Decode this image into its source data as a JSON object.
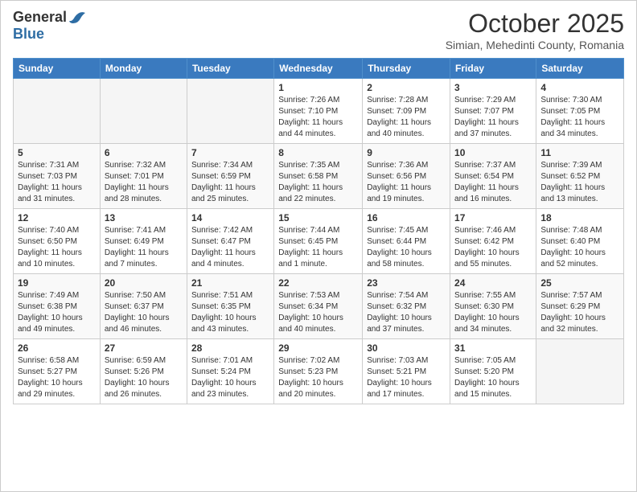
{
  "header": {
    "logo_line1": "General",
    "logo_line2": "Blue",
    "month": "October 2025",
    "location": "Simian, Mehedinti County, Romania"
  },
  "weekdays": [
    "Sunday",
    "Monday",
    "Tuesday",
    "Wednesday",
    "Thursday",
    "Friday",
    "Saturday"
  ],
  "weeks": [
    [
      {
        "day": "",
        "info": ""
      },
      {
        "day": "",
        "info": ""
      },
      {
        "day": "",
        "info": ""
      },
      {
        "day": "1",
        "info": "Sunrise: 7:26 AM\nSunset: 7:10 PM\nDaylight: 11 hours\nand 44 minutes."
      },
      {
        "day": "2",
        "info": "Sunrise: 7:28 AM\nSunset: 7:09 PM\nDaylight: 11 hours\nand 40 minutes."
      },
      {
        "day": "3",
        "info": "Sunrise: 7:29 AM\nSunset: 7:07 PM\nDaylight: 11 hours\nand 37 minutes."
      },
      {
        "day": "4",
        "info": "Sunrise: 7:30 AM\nSunset: 7:05 PM\nDaylight: 11 hours\nand 34 minutes."
      }
    ],
    [
      {
        "day": "5",
        "info": "Sunrise: 7:31 AM\nSunset: 7:03 PM\nDaylight: 11 hours\nand 31 minutes."
      },
      {
        "day": "6",
        "info": "Sunrise: 7:32 AM\nSunset: 7:01 PM\nDaylight: 11 hours\nand 28 minutes."
      },
      {
        "day": "7",
        "info": "Sunrise: 7:34 AM\nSunset: 6:59 PM\nDaylight: 11 hours\nand 25 minutes."
      },
      {
        "day": "8",
        "info": "Sunrise: 7:35 AM\nSunset: 6:58 PM\nDaylight: 11 hours\nand 22 minutes."
      },
      {
        "day": "9",
        "info": "Sunrise: 7:36 AM\nSunset: 6:56 PM\nDaylight: 11 hours\nand 19 minutes."
      },
      {
        "day": "10",
        "info": "Sunrise: 7:37 AM\nSunset: 6:54 PM\nDaylight: 11 hours\nand 16 minutes."
      },
      {
        "day": "11",
        "info": "Sunrise: 7:39 AM\nSunset: 6:52 PM\nDaylight: 11 hours\nand 13 minutes."
      }
    ],
    [
      {
        "day": "12",
        "info": "Sunrise: 7:40 AM\nSunset: 6:50 PM\nDaylight: 11 hours\nand 10 minutes."
      },
      {
        "day": "13",
        "info": "Sunrise: 7:41 AM\nSunset: 6:49 PM\nDaylight: 11 hours\nand 7 minutes."
      },
      {
        "day": "14",
        "info": "Sunrise: 7:42 AM\nSunset: 6:47 PM\nDaylight: 11 hours\nand 4 minutes."
      },
      {
        "day": "15",
        "info": "Sunrise: 7:44 AM\nSunset: 6:45 PM\nDaylight: 11 hours\nand 1 minute."
      },
      {
        "day": "16",
        "info": "Sunrise: 7:45 AM\nSunset: 6:44 PM\nDaylight: 10 hours\nand 58 minutes."
      },
      {
        "day": "17",
        "info": "Sunrise: 7:46 AM\nSunset: 6:42 PM\nDaylight: 10 hours\nand 55 minutes."
      },
      {
        "day": "18",
        "info": "Sunrise: 7:48 AM\nSunset: 6:40 PM\nDaylight: 10 hours\nand 52 minutes."
      }
    ],
    [
      {
        "day": "19",
        "info": "Sunrise: 7:49 AM\nSunset: 6:38 PM\nDaylight: 10 hours\nand 49 minutes."
      },
      {
        "day": "20",
        "info": "Sunrise: 7:50 AM\nSunset: 6:37 PM\nDaylight: 10 hours\nand 46 minutes."
      },
      {
        "day": "21",
        "info": "Sunrise: 7:51 AM\nSunset: 6:35 PM\nDaylight: 10 hours\nand 43 minutes."
      },
      {
        "day": "22",
        "info": "Sunrise: 7:53 AM\nSunset: 6:34 PM\nDaylight: 10 hours\nand 40 minutes."
      },
      {
        "day": "23",
        "info": "Sunrise: 7:54 AM\nSunset: 6:32 PM\nDaylight: 10 hours\nand 37 minutes."
      },
      {
        "day": "24",
        "info": "Sunrise: 7:55 AM\nSunset: 6:30 PM\nDaylight: 10 hours\nand 34 minutes."
      },
      {
        "day": "25",
        "info": "Sunrise: 7:57 AM\nSunset: 6:29 PM\nDaylight: 10 hours\nand 32 minutes."
      }
    ],
    [
      {
        "day": "26",
        "info": "Sunrise: 6:58 AM\nSunset: 5:27 PM\nDaylight: 10 hours\nand 29 minutes."
      },
      {
        "day": "27",
        "info": "Sunrise: 6:59 AM\nSunset: 5:26 PM\nDaylight: 10 hours\nand 26 minutes."
      },
      {
        "day": "28",
        "info": "Sunrise: 7:01 AM\nSunset: 5:24 PM\nDaylight: 10 hours\nand 23 minutes."
      },
      {
        "day": "29",
        "info": "Sunrise: 7:02 AM\nSunset: 5:23 PM\nDaylight: 10 hours\nand 20 minutes."
      },
      {
        "day": "30",
        "info": "Sunrise: 7:03 AM\nSunset: 5:21 PM\nDaylight: 10 hours\nand 17 minutes."
      },
      {
        "day": "31",
        "info": "Sunrise: 7:05 AM\nSunset: 5:20 PM\nDaylight: 10 hours\nand 15 minutes."
      },
      {
        "day": "",
        "info": ""
      }
    ]
  ]
}
